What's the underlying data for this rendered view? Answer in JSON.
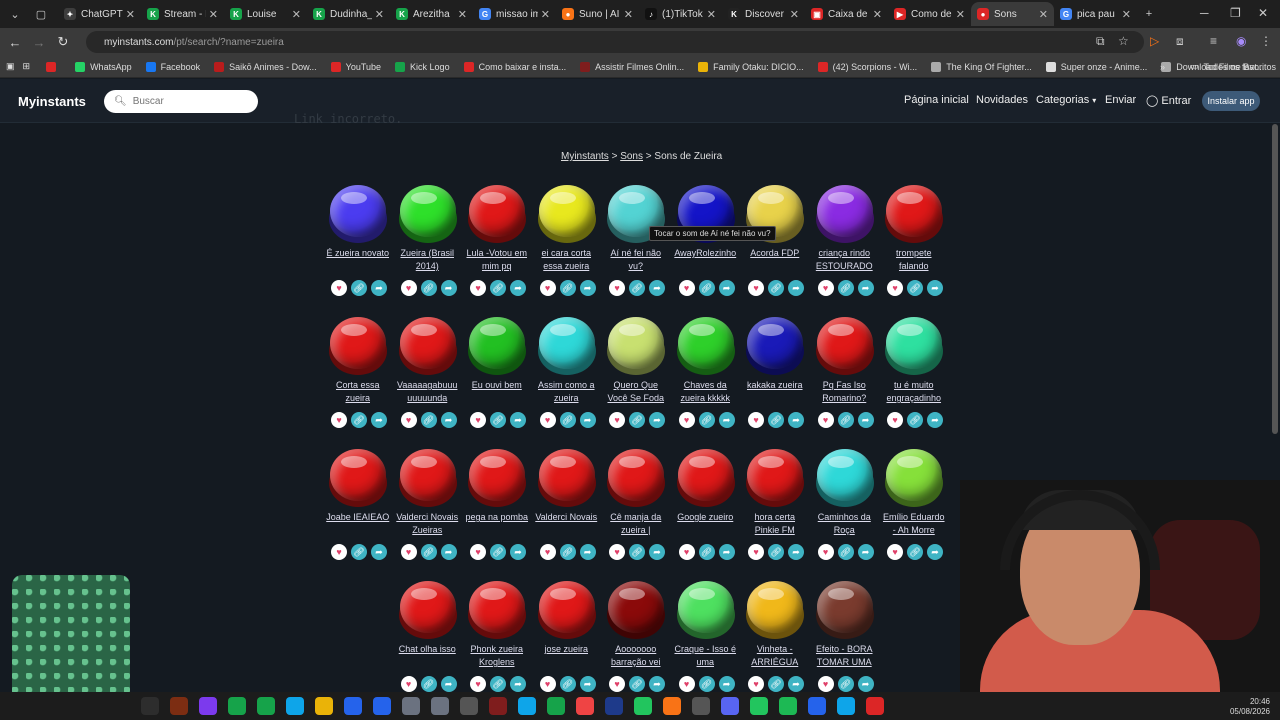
{
  "browser": {
    "tabs": [
      {
        "title": "ChatGPT",
        "color": "#3d3d3d",
        "glyph": "✦"
      },
      {
        "title": "Stream - K",
        "color": "#16a34a",
        "glyph": "K"
      },
      {
        "title": "Louise",
        "color": "#16a34a",
        "glyph": "K"
      },
      {
        "title": "Dudinha_",
        "color": "#16a34a",
        "glyph": "K"
      },
      {
        "title": "Arezitha",
        "color": "#16a34a",
        "glyph": "K"
      },
      {
        "title": "missao im",
        "color": "#4285f4",
        "glyph": "G"
      },
      {
        "title": "Suno | AI",
        "color": "#f97316",
        "glyph": "●"
      },
      {
        "title": "(1)TikTok",
        "color": "#111111",
        "glyph": "♪"
      },
      {
        "title": "Discover",
        "color": "#222222",
        "glyph": "K"
      },
      {
        "title": "Caixa de e",
        "color": "#dc2626",
        "glyph": "▣"
      },
      {
        "title": "Como de",
        "color": "#dc2626",
        "glyph": "▶"
      },
      {
        "title": "Sons",
        "color": "#dc2626",
        "glyph": "●"
      },
      {
        "title": "pica pau",
        "color": "#4285f4",
        "glyph": "G"
      }
    ],
    "active_tab": 11,
    "url_host": "myinstants.com",
    "url_path": "/pt/search/?name=zueira",
    "bookmarks": [
      {
        "label": "",
        "color": "#dc2626"
      },
      {
        "label": "WhatsApp",
        "color": "#25d366"
      },
      {
        "label": "Facebook",
        "color": "#1877f2"
      },
      {
        "label": "Saikō Animes - Dow...",
        "color": "#b91c1c"
      },
      {
        "label": "YouTube",
        "color": "#dc2626"
      },
      {
        "label": "Kick Logo",
        "color": "#16a34a"
      },
      {
        "label": "Como baixar e insta...",
        "color": "#dc2626"
      },
      {
        "label": "Assistir Filmes Onlin...",
        "color": "#7f1d1d"
      },
      {
        "label": "Family Otaku: DICIO...",
        "color": "#eab308"
      },
      {
        "label": "(42) Scorpions - Wi...",
        "color": "#dc2626"
      },
      {
        "label": "The King Of Fighter...",
        "color": "#aaaaaa"
      },
      {
        "label": "Super onze - Anime...",
        "color": "#dddddd"
      },
      {
        "label": "Download Filme Bat...",
        "color": "#aaaaaa"
      }
    ],
    "favorites_label": "Todos os favoritos"
  },
  "site": {
    "logo": "Myinstants",
    "search_placeholder": "Buscar",
    "nav": {
      "home": "Página inicial",
      "news": "Novidades",
      "categories": "Categorias",
      "send": "Enviar",
      "login": "Entrar",
      "install": "Instalar app"
    },
    "ghost_text": "Link incorreto.",
    "breadcrumb": {
      "root": "Myinstants",
      "section": "Sons",
      "current": "Sons de Zueira",
      "sep": ">"
    },
    "tooltip": "Tocar o som de Aí né fei não vu?"
  },
  "sounds": [
    {
      "label": "É zueira novato",
      "color": "#4b3cf0"
    },
    {
      "label": "Zueira (Brasil 2014)",
      "color": "#2ee02a"
    },
    {
      "label": "Lula -Votou em mim pq",
      "color": "#e01818"
    },
    {
      "label": "ei cara corta essa zueira",
      "color": "#e8e81e"
    },
    {
      "label": "Aí né fei não vu?",
      "color": "#53d3d3"
    },
    {
      "label": "AwayRolezinho",
      "color": "#1414c8"
    },
    {
      "label": "Acorda FDP",
      "color": "#e8d24a"
    },
    {
      "label": "criança rindo ESTOURADO",
      "color": "#8a2be2"
    },
    {
      "label": "trompete falando",
      "color": "#e01818"
    },
    {
      "label": "Corta essa zueira",
      "color": "#e01818"
    },
    {
      "label": "Vaaaaagabuuu uuuuunda",
      "color": "#e01818"
    },
    {
      "label": "Eu ouvi bem",
      "color": "#22c022"
    },
    {
      "label": "Assim como a zueira",
      "color": "#2ed8d8"
    },
    {
      "label": "Quero Que Você Se Foda",
      "color": "#c8e070"
    },
    {
      "label": "Chaves da zueira kkkkk",
      "color": "#2ed02a"
    },
    {
      "label": "kakaka zueira",
      "color": "#1a1ab8"
    },
    {
      "label": "Pq Fas Iso Romarino?",
      "color": "#e01818"
    },
    {
      "label": "tu é muito engraçadinho",
      "color": "#2ee0a0"
    },
    {
      "label": "Joabe IEAIEAO",
      "color": "#e01818"
    },
    {
      "label": "Valderci Novais Zueiras",
      "color": "#e01818"
    },
    {
      "label": "pega na pomba",
      "color": "#e01818"
    },
    {
      "label": "Valderci Novais",
      "color": "#e01818"
    },
    {
      "label": "Cê manja da zueira |",
      "color": "#e01818"
    },
    {
      "label": "Google zueiro",
      "color": "#e01818"
    },
    {
      "label": "hora certa Pinkie FM",
      "color": "#e01818"
    },
    {
      "label": "Caminhos da Roça",
      "color": "#2ed8d8"
    },
    {
      "label": "Emílio Eduardo - Ah Morre",
      "color": "#86e03a"
    },
    {
      "label": "",
      "color": ""
    },
    {
      "label": "Chat olha isso",
      "color": "#e01818"
    },
    {
      "label": "Phonk zueira Kroglens",
      "color": "#e01818"
    },
    {
      "label": "jose zueira",
      "color": "#e01818"
    },
    {
      "label": "Aooooooo barração vei",
      "color": "#8b0a0a"
    },
    {
      "label": "Craque - Isso é uma",
      "color": "#4ee060"
    },
    {
      "label": "Vinheta - ARRIÉGUA",
      "color": "#f0b81a"
    },
    {
      "label": "Efeito - BORA TOMAR UMA",
      "color": "#7a3b2e"
    }
  ],
  "taskbar": {
    "time": "20:46",
    "date": "05/08/2026"
  }
}
